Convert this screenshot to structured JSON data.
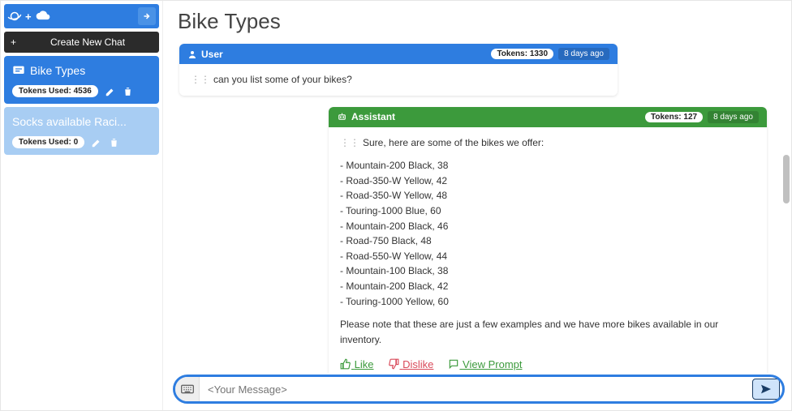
{
  "page_title": "Bike Types",
  "sidebar": {
    "new_chat_label": "Create New Chat",
    "chats": [
      {
        "title": "Bike Types",
        "tokens_label": "Tokens Used: 4536",
        "active": true
      },
      {
        "title": "Socks available Raci...",
        "tokens_label": "Tokens Used: 0",
        "active": false
      }
    ]
  },
  "messages": {
    "user": {
      "role": "User",
      "tokens": "Tokens: 1330",
      "age": "8 days ago",
      "text": "can you list some of your bikes?"
    },
    "assistant": {
      "role": "Assistant",
      "tokens": "Tokens: 127",
      "age": "8 days ago",
      "intro": "Sure, here are some of the bikes we offer:",
      "items": [
        "- Mountain-200 Black, 38",
        "- Road-350-W Yellow, 42",
        "- Road-350-W Yellow, 48",
        "- Touring-1000 Blue, 60",
        "- Mountain-200 Black, 46",
        "- Road-750 Black, 48",
        "- Road-550-W Yellow, 44",
        "- Mountain-100 Black, 38",
        "- Mountain-200 Black, 42",
        "- Touring-1000 Yellow, 60"
      ],
      "outro": "Please note that these are just a few examples and we have more bikes available in our inventory.",
      "actions": {
        "like": "Like",
        "dislike": "Dislike",
        "view": "View Prompt"
      }
    }
  },
  "composer": {
    "placeholder": "<Your Message>"
  }
}
